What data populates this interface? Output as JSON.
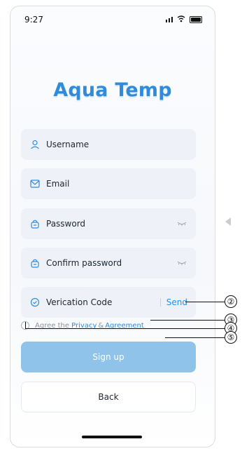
{
  "status_bar": {
    "time": "9:27"
  },
  "app": {
    "logo_text": "Aqua Temp"
  },
  "form": {
    "username_placeholder": "Username",
    "email_placeholder": "Email",
    "password_placeholder": "Password",
    "confirm_password_placeholder": "Confirm password",
    "verification_code_placeholder": "Verication Code",
    "send_code_label": "Send"
  },
  "agreement": {
    "prefix": "Agree the",
    "privacy_link": "Privacy",
    "and": "&",
    "agreement_link": "Agreement"
  },
  "buttons": {
    "sign_up": "Sign up",
    "back": "Back"
  },
  "callouts": [
    "②",
    "③",
    "④",
    "⑤"
  ],
  "colors": {
    "accent": "#2f8cdc",
    "field_bg": "#eef2f8",
    "primary_button": "#8fc3ea"
  },
  "icons": [
    "signal-icon",
    "wifi-icon",
    "battery-icon",
    "user-icon",
    "mail-icon",
    "lock-icon",
    "eye-hidden-icon",
    "shield-check-icon",
    "radio-button-icon",
    "left-arrow-icon"
  ]
}
